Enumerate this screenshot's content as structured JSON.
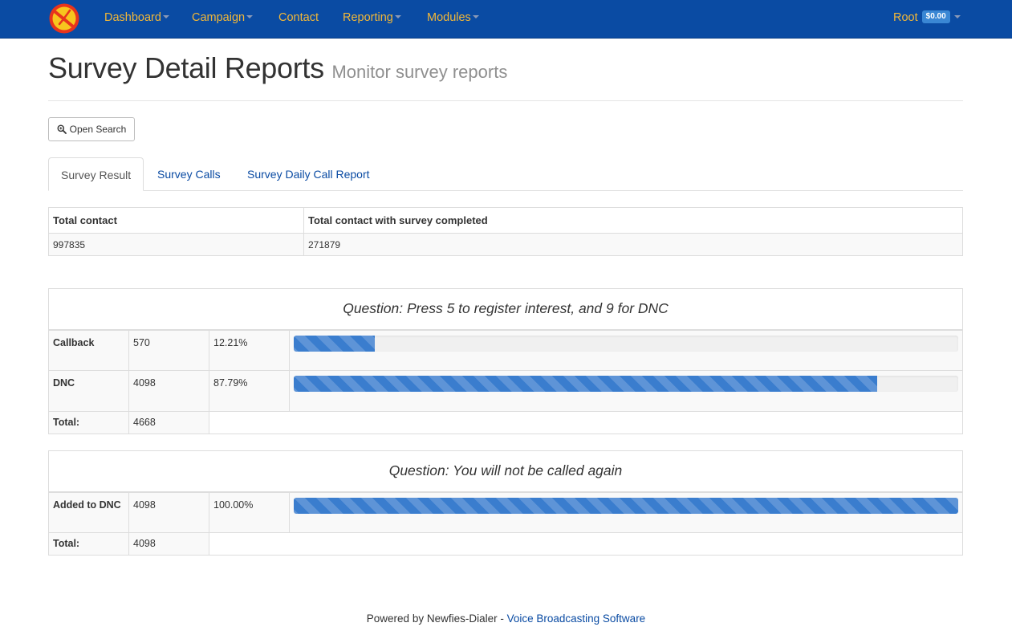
{
  "navbar": {
    "logo": "newfies-logo-icon",
    "items": [
      {
        "label": "Dashboard",
        "dropdown": true
      },
      {
        "label": "Campaign",
        "dropdown": true
      },
      {
        "label": "Contact",
        "dropdown": false
      },
      {
        "label": "Reporting",
        "dropdown": true
      },
      {
        "label": "Modules",
        "dropdown": true
      }
    ],
    "user": {
      "label": "Root",
      "balance": "$0.00"
    }
  },
  "header": {
    "title": "Survey Detail Reports",
    "subtitle": "Monitor survey reports"
  },
  "search_button": {
    "label": "Open Search",
    "icon": "zoom-in-icon"
  },
  "tabs": [
    {
      "label": "Survey Result",
      "active": true
    },
    {
      "label": "Survey Calls",
      "active": false
    },
    {
      "label": "Survey Daily Call Report",
      "active": false
    }
  ],
  "summary": {
    "headers": [
      "Total contact",
      "Total contact with survey completed"
    ],
    "values": [
      "997835",
      "271879"
    ]
  },
  "questions": [
    {
      "title": "Question: Press 5 to register interest, and 9 for DNC",
      "answers": [
        {
          "label": "Callback",
          "count": "570",
          "percent_text": "12.21%",
          "percent": 12.21
        },
        {
          "label": "DNC",
          "count": "4098",
          "percent_text": "87.79%",
          "percent": 87.79
        }
      ],
      "total_label": "Total:",
      "total": "4668"
    },
    {
      "title": "Question: You will not be called again",
      "answers": [
        {
          "label": "Added to DNC",
          "count": "4098",
          "percent_text": "100.00%",
          "percent": 100.0
        }
      ],
      "total_label": "Total:",
      "total": "4098"
    }
  ],
  "footer": {
    "prefix": "Powered by Newfies-Dialer - ",
    "link": "Voice Broadcasting Software"
  },
  "colors": {
    "navbar_bg": "#0a4ba3",
    "nav_text": "#f2b737",
    "bar": "#3a7dce",
    "link": "#0a4ba3"
  }
}
